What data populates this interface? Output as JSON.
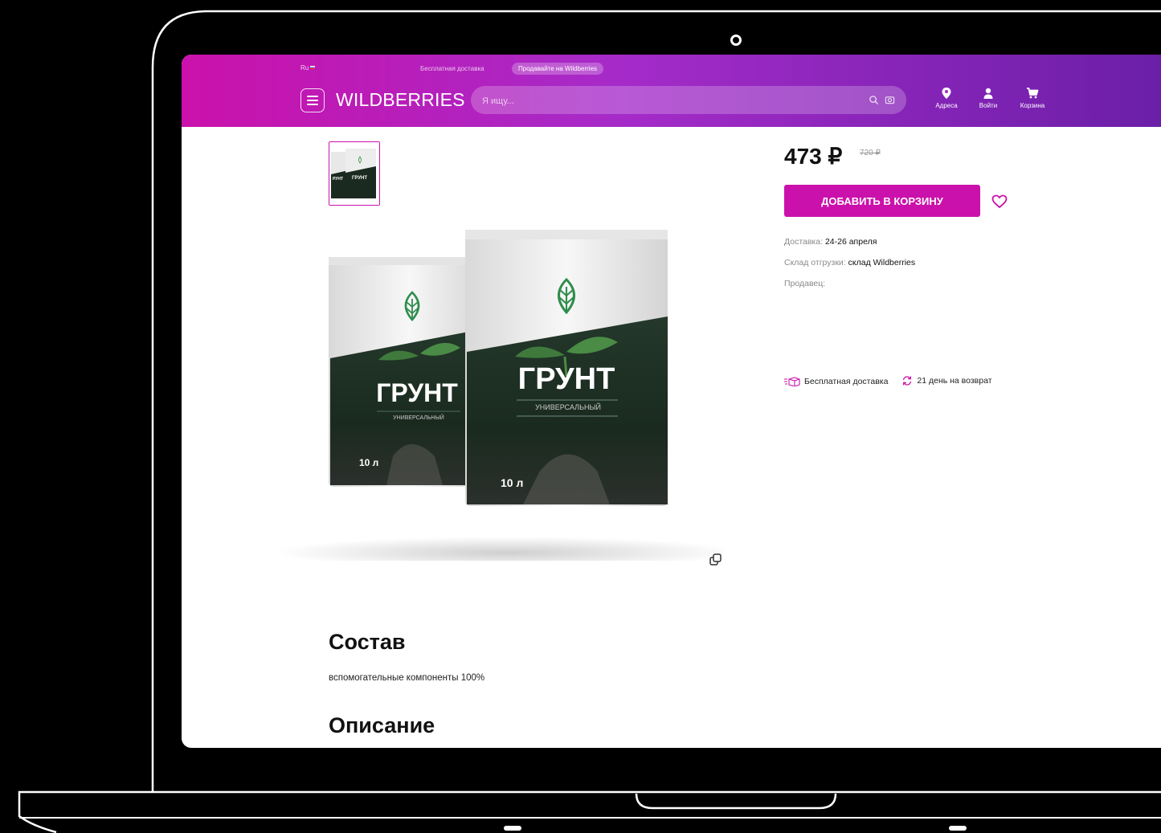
{
  "topbar": {
    "language": "Ru",
    "free_delivery": "Бесплатная доставка",
    "sell_on": "Продавайте на Wildberries"
  },
  "header": {
    "logo": "WILDBERRIES",
    "search_placeholder": "Я ищу...",
    "nav": [
      {
        "label": "Адреса",
        "icon": "location-pin-icon"
      },
      {
        "label": "Войти",
        "icon": "user-icon"
      },
      {
        "label": "Корзина",
        "icon": "cart-icon"
      }
    ]
  },
  "product": {
    "package_title": "ГРУНТ",
    "package_subtitle": "УНИВЕРСАЛЬНЫЙ",
    "package_volume": "10 л",
    "price": "473 ₽",
    "old_price": "720 ₽",
    "add_to_cart": "ДОБАВИТЬ В КОРЗИНУ",
    "delivery_label": "Доставка:",
    "delivery_value": "24-26 апреля",
    "warehouse_label": "Склад отгрузки:",
    "warehouse_value": "склад Wildberries",
    "seller_label": "Продавец:",
    "free_delivery_badge": "Бесплатная доставка",
    "return_badge": "21 день на возврат",
    "composition_title": "Состав",
    "composition_text": "вспомогательные компоненты 100%",
    "description_title": "Описание"
  },
  "colors": {
    "brand": "#cb11ab",
    "header_end": "#6b1fa8"
  }
}
